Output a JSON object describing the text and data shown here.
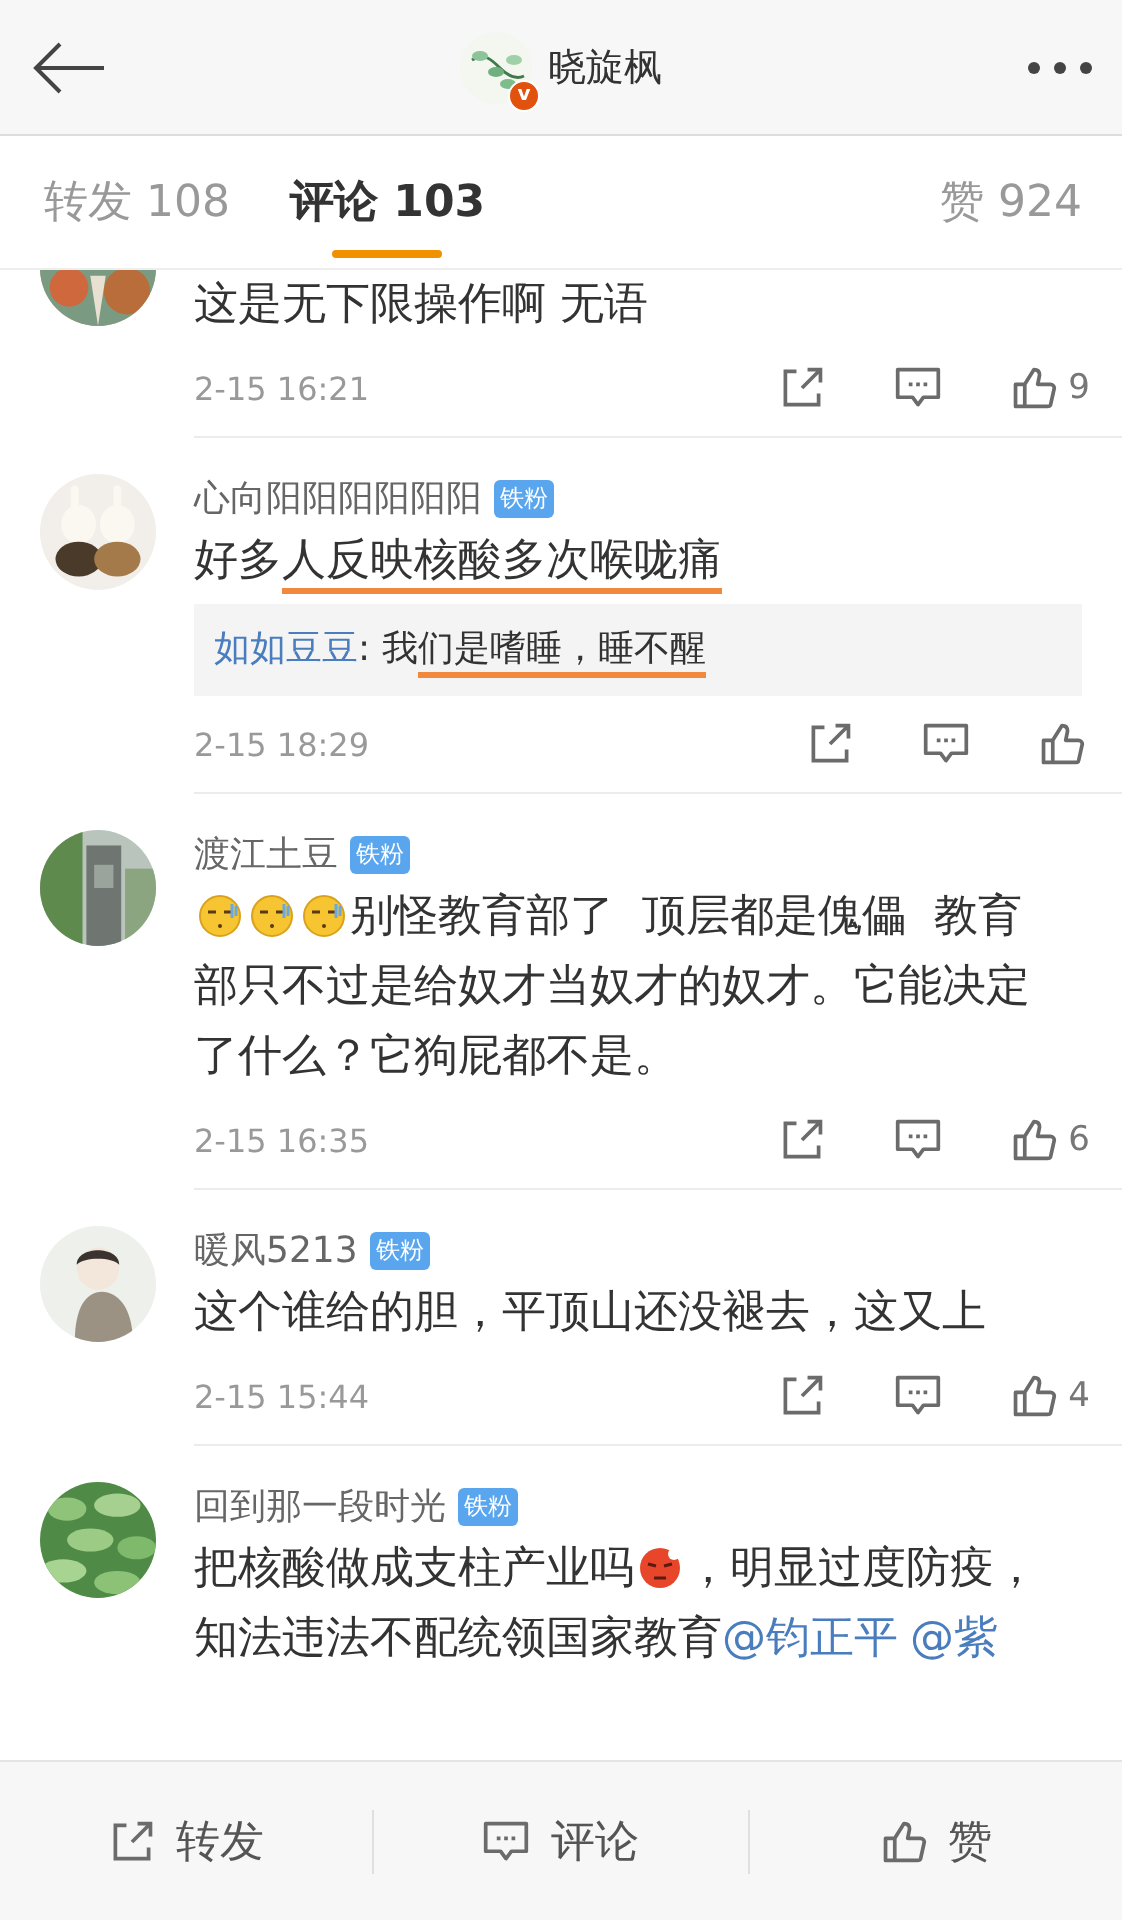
{
  "header": {
    "title": "晓旋枫",
    "verified_badge": "v"
  },
  "tabs": [
    {
      "label": "转发 108",
      "selected": false
    },
    {
      "label": "评论 103",
      "selected": true
    },
    {
      "label": "赞 924",
      "selected": false
    }
  ],
  "comments": [
    {
      "segments": [
        {
          "kind": "text",
          "text": "这是无下限操作啊 无语"
        }
      ],
      "time": "2-15 16:21",
      "likes": "9"
    },
    {
      "author": "心向阳阳阳阳阳阳",
      "badge": "铁粉",
      "segments": [
        {
          "kind": "text",
          "text": "好多"
        },
        {
          "kind": "text",
          "text": "人反映核酸多次喉咙痛",
          "underlined": true
        }
      ],
      "reply": {
        "author": "如如豆豆",
        "segments": [
          {
            "kind": "text",
            "text": ": 我"
          },
          {
            "kind": "text",
            "text": "们是嗜睡，睡不醒",
            "underlined": true
          }
        ]
      },
      "time": "2-15 18:29"
    },
    {
      "author": "渡江土豆",
      "badge": "铁粉",
      "segments": [
        {
          "kind": "emoji"
        },
        {
          "kind": "emoji"
        },
        {
          "kind": "emoji"
        },
        {
          "kind": "text",
          "text": "别怪教育部了  顶层都是傀儡  教育部只不过是给奴才当奴才的奴才。它能决定了什么？它狗屁都不是。"
        }
      ],
      "time": "2-15 16:35",
      "likes": "6"
    },
    {
      "author": "暖风5213",
      "badge": "铁粉",
      "segments": [
        {
          "kind": "text",
          "text": "这个谁给的胆，平顶山还没褪去，这又上"
        }
      ],
      "time": "2-15 15:44",
      "likes": "4"
    },
    {
      "author": "回到那一段时光",
      "badge": "铁粉",
      "segments": [
        {
          "kind": "text",
          "text": "把核酸做成支柱产业吗"
        },
        {
          "kind": "rage"
        },
        {
          "kind": "text",
          "text": "，明显过度防疫，知法违法不配统领国家教育"
        },
        {
          "kind": "mention",
          "text": "@钧正平"
        },
        {
          "kind": "mention",
          "text": "@紫"
        }
      ]
    }
  ],
  "bottom_bar": [
    {
      "kind": "repost",
      "label": "转发"
    },
    {
      "kind": "comment",
      "label": "评论"
    },
    {
      "kind": "like",
      "label": "赞"
    }
  ]
}
